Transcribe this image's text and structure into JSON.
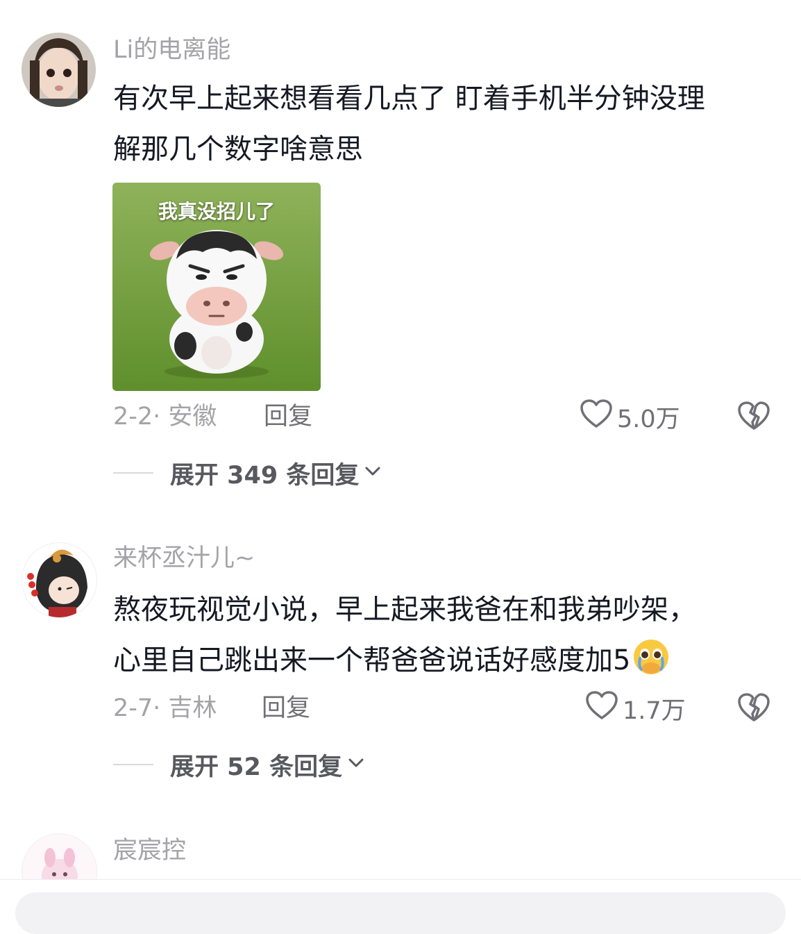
{
  "comments": [
    {
      "username": "Li的电离能",
      "text_lines": [
        "有次早上起来想看看几点了 盯着手机半分钟没理",
        "解那几个数字啥意思"
      ],
      "sticker_caption": "我真没招儿了",
      "date_location": "2-2· 安徽",
      "reply_label": "回复",
      "likes": "5.0万",
      "expand_label": "展开 349 条回复"
    },
    {
      "username": "来杯丞汁儿~",
      "text_lines": [
        "熬夜玩视觉小说，早上起来我爸在和我弟吵架，",
        "心里自己跳出来一个帮爸爸说话好感度加5"
      ],
      "emoji": "pleading-face-hands",
      "date_location": "2-7· 吉林",
      "reply_label": "回复",
      "likes": "1.7万",
      "expand_label": "展开 52 条回复"
    },
    {
      "username": "宸宸控"
    }
  ],
  "colors": {
    "primary_text": "#161823",
    "secondary_text": "#a3a3a8",
    "action_text": "#6f6f75",
    "grass": "#6f9e3a"
  },
  "icons": {
    "like": "heart-outline-icon",
    "dislike": "broken-heart-icon",
    "expand": "chevron-down-icon"
  }
}
